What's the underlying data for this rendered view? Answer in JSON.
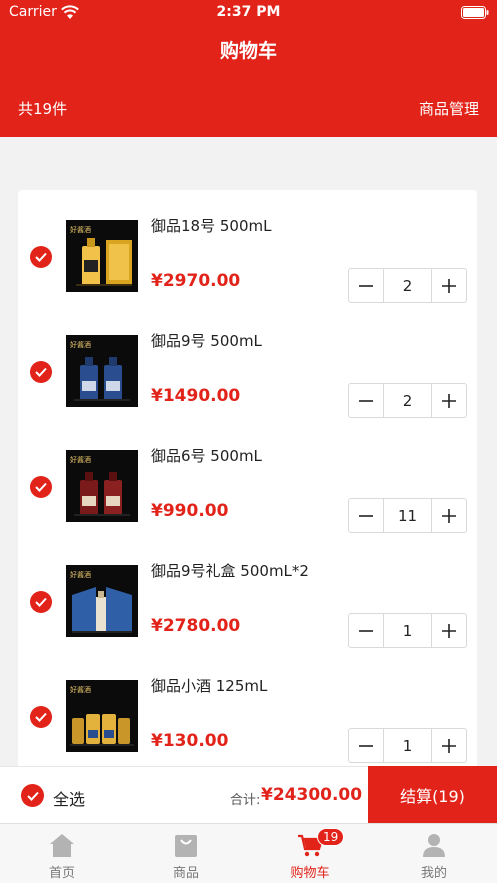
{
  "status_bar": {
    "carrier": "Carrier",
    "time": "2:37 PM"
  },
  "header": {
    "title": "购物车",
    "item_count": "共19件",
    "manage_label": "商品管理"
  },
  "cart": {
    "items": [
      {
        "name": "御品18号 500mL",
        "price": "¥2970.00",
        "quantity": "2",
        "selected": true,
        "label_text": "好酱酒"
      },
      {
        "name": "御品9号 500mL",
        "price": "¥1490.00",
        "quantity": "2",
        "selected": true,
        "label_text": "好酱酒"
      },
      {
        "name": "御品6号 500mL",
        "price": "¥990.00",
        "quantity": "11",
        "selected": true,
        "label_text": "好酱酒"
      },
      {
        "name": "御品9号礼盒 500mL*2",
        "price": "¥2780.00",
        "quantity": "1",
        "selected": true,
        "label_text": "好酱酒"
      },
      {
        "name": "御品小酒 125mL",
        "price": "¥130.00",
        "quantity": "1",
        "selected": true,
        "label_text": "好酱酒"
      }
    ]
  },
  "checkout": {
    "select_all_label": "全选",
    "total_label": "合计:",
    "total_value": "¥24300.00",
    "checkout_label": "结算(19)"
  },
  "tabbar": {
    "tabs": [
      {
        "label": "首页",
        "icon": "home-icon"
      },
      {
        "label": "商品",
        "icon": "shopping-bag-icon"
      },
      {
        "label": "购物车",
        "icon": "cart-icon",
        "badge": "19",
        "active": true
      },
      {
        "label": "我的",
        "icon": "user-icon"
      }
    ]
  },
  "colors": {
    "accent": "#e2231a",
    "background": "#f2f2f2",
    "inactive_tab": "#777777"
  }
}
